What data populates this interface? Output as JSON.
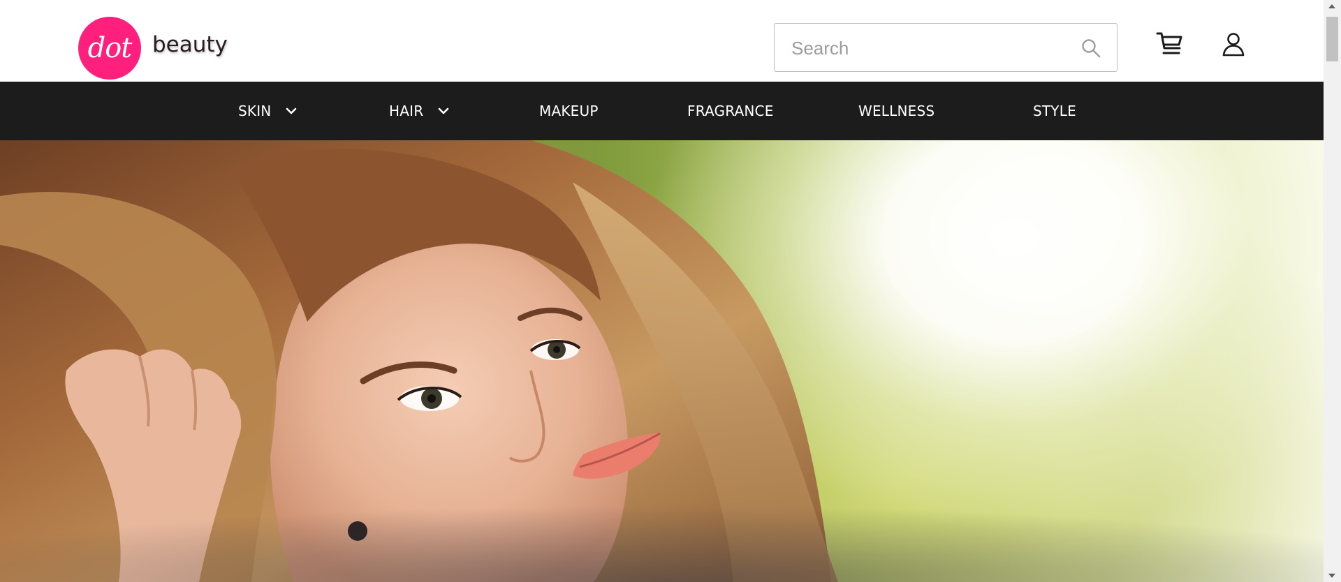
{
  "brand": {
    "logo_mark": "dot",
    "logo_word": "beauty",
    "logo_color": "#ff1f7d"
  },
  "search": {
    "placeholder": "Search",
    "value": "",
    "icon": "search-icon"
  },
  "header_icons": {
    "cart": "cart-icon",
    "account": "user-icon"
  },
  "nav": {
    "background": "#1c1c1c",
    "items": [
      {
        "label": "SKIN",
        "has_dropdown": true
      },
      {
        "label": "HAIR",
        "has_dropdown": true
      },
      {
        "label": "MAKEUP",
        "has_dropdown": false
      },
      {
        "label": "FRAGRANCE",
        "has_dropdown": false
      },
      {
        "label": "WELLNESS",
        "has_dropdown": false
      },
      {
        "label": "STYLE",
        "has_dropdown": false
      }
    ]
  },
  "hero": {
    "image": "hero-portrait-image"
  }
}
